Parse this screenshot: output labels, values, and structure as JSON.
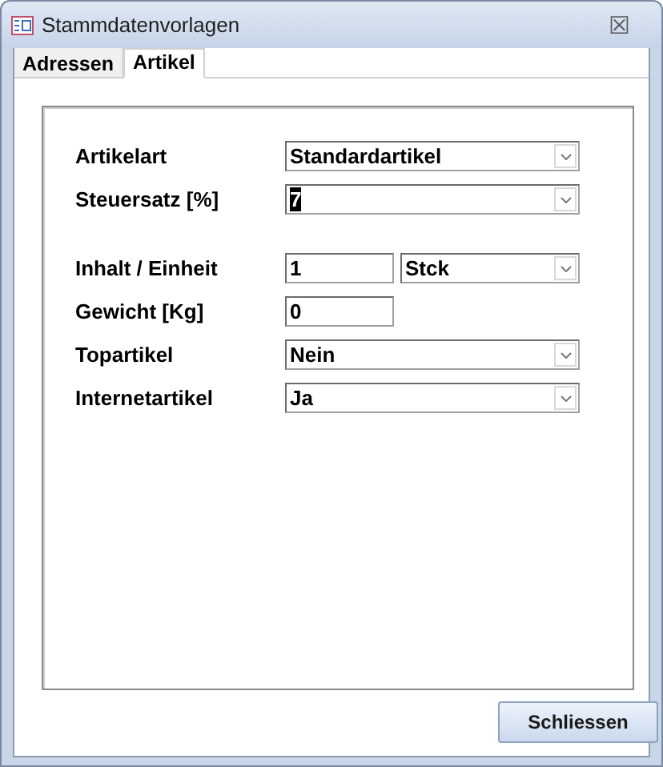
{
  "window": {
    "title": "Stammdatenvorlagen",
    "close_symbol": "☒"
  },
  "tabs": [
    {
      "label": "Adressen",
      "selected": false
    },
    {
      "label": "Artikel",
      "selected": true
    }
  ],
  "form": {
    "rows": [
      {
        "label": "Artikelart",
        "controls": [
          {
            "kind": "combo",
            "value": "Standardartikel",
            "highlighted": false
          }
        ]
      },
      {
        "label": "Steuersatz [%]",
        "controls": [
          {
            "kind": "combo",
            "value": "7",
            "highlighted": true
          }
        ]
      },
      {
        "label": "Inhalt / Einheit",
        "controls": [
          {
            "kind": "text",
            "value": "1",
            "highlighted": false
          },
          {
            "kind": "combo",
            "value": "Stck",
            "highlighted": false
          }
        ]
      },
      {
        "label": "Gewicht [Kg]",
        "controls": [
          {
            "kind": "text",
            "value": "0",
            "highlighted": false
          }
        ]
      },
      {
        "label": "Topartikel",
        "controls": [
          {
            "kind": "combo",
            "value": "Nein",
            "highlighted": false
          }
        ]
      },
      {
        "label": "Internetartikel",
        "controls": [
          {
            "kind": "combo",
            "value": "Ja",
            "highlighted": false
          }
        ]
      }
    ]
  },
  "buttons": [
    {
      "label": "Schliessen"
    }
  ]
}
